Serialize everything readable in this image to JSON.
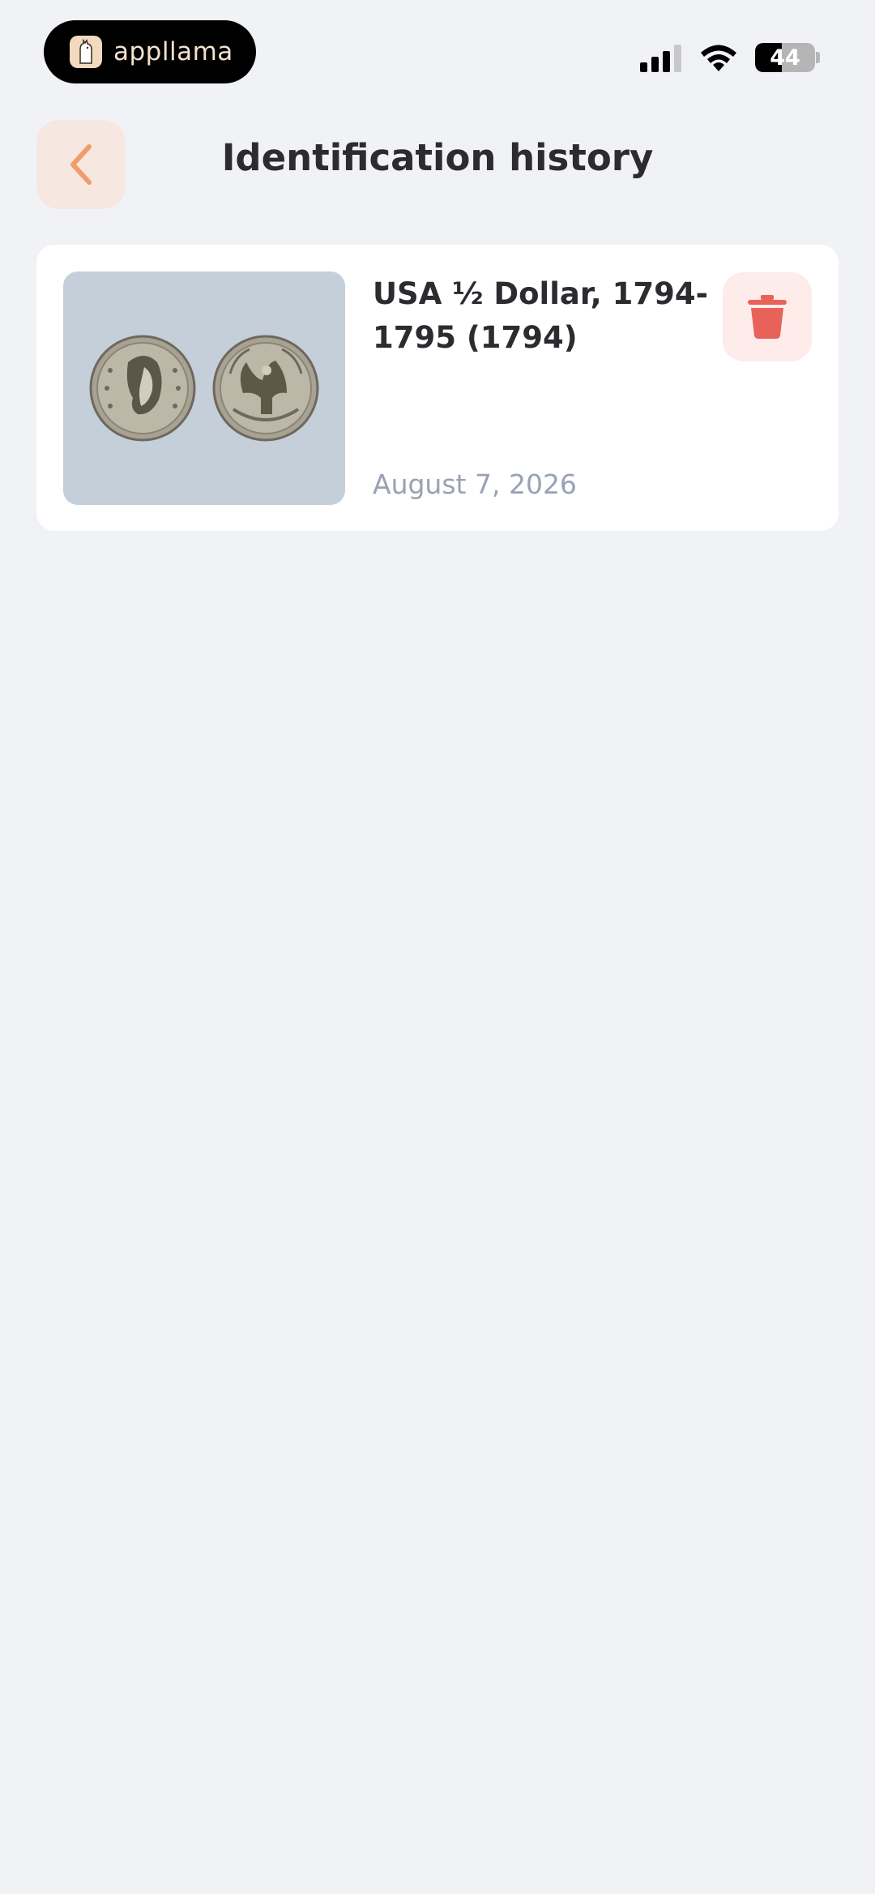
{
  "status_bar": {
    "app_name": "appllama",
    "battery_level": "44",
    "battery_fraction": 0.44
  },
  "header": {
    "title": "Identification history",
    "back_icon": "chevron-left-icon"
  },
  "history": {
    "items": [
      {
        "title": "USA ½ Dollar, 1794-1795 (1794)",
        "date": "August 7, 2026",
        "delete_icon": "trash-icon"
      }
    ]
  },
  "colors": {
    "background": "#f1f2f6",
    "accent_orange": "#f09c6b",
    "delete_red": "#e8625a",
    "date_gray": "#98a2b5"
  }
}
